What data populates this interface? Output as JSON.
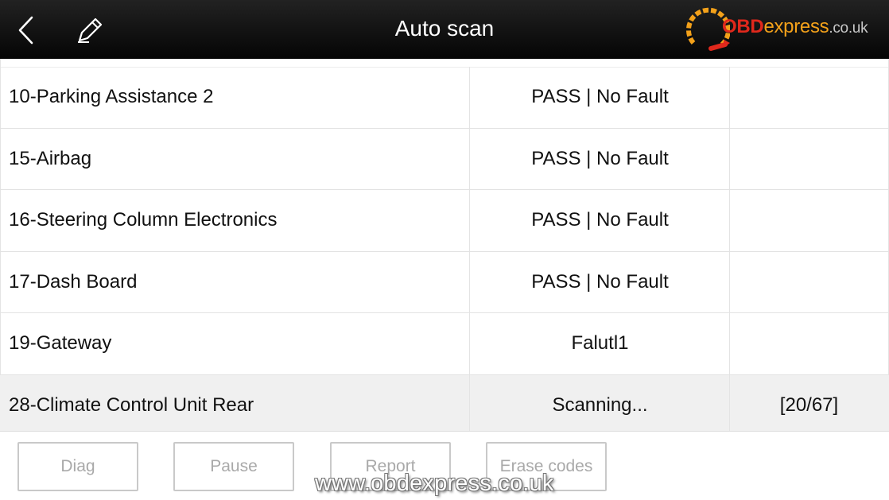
{
  "header": {
    "title": "Auto scan",
    "back_icon": "chevron-left-icon",
    "edit_icon": "pencil-icon"
  },
  "logo": {
    "brand_obd": "OBD",
    "brand_express": "express",
    "brand_tld": ".co.uk",
    "colors": {
      "obd": "#e0281c",
      "express": "#f3a11a"
    }
  },
  "rows": [
    {
      "name": "10-Parking Assistance 2",
      "status": "PASS | No Fault",
      "extra": ""
    },
    {
      "name": "15-Airbag",
      "status": "PASS | No Fault",
      "extra": ""
    },
    {
      "name": "16-Steering Column Electronics",
      "status": "PASS | No Fault",
      "extra": ""
    },
    {
      "name": "17-Dash Board",
      "status": "PASS | No Fault",
      "extra": ""
    },
    {
      "name": "19-Gateway",
      "status": "Falutl1",
      "extra": ""
    },
    {
      "name": "28-Climate Control Unit Rear",
      "status": "Scanning...",
      "extra": "[20/67]"
    }
  ],
  "buttons": {
    "diag": "Diag",
    "pause": "Pause",
    "report": "Report",
    "erase": "Erase codes"
  },
  "watermark": "www.obdexpress.co.uk"
}
